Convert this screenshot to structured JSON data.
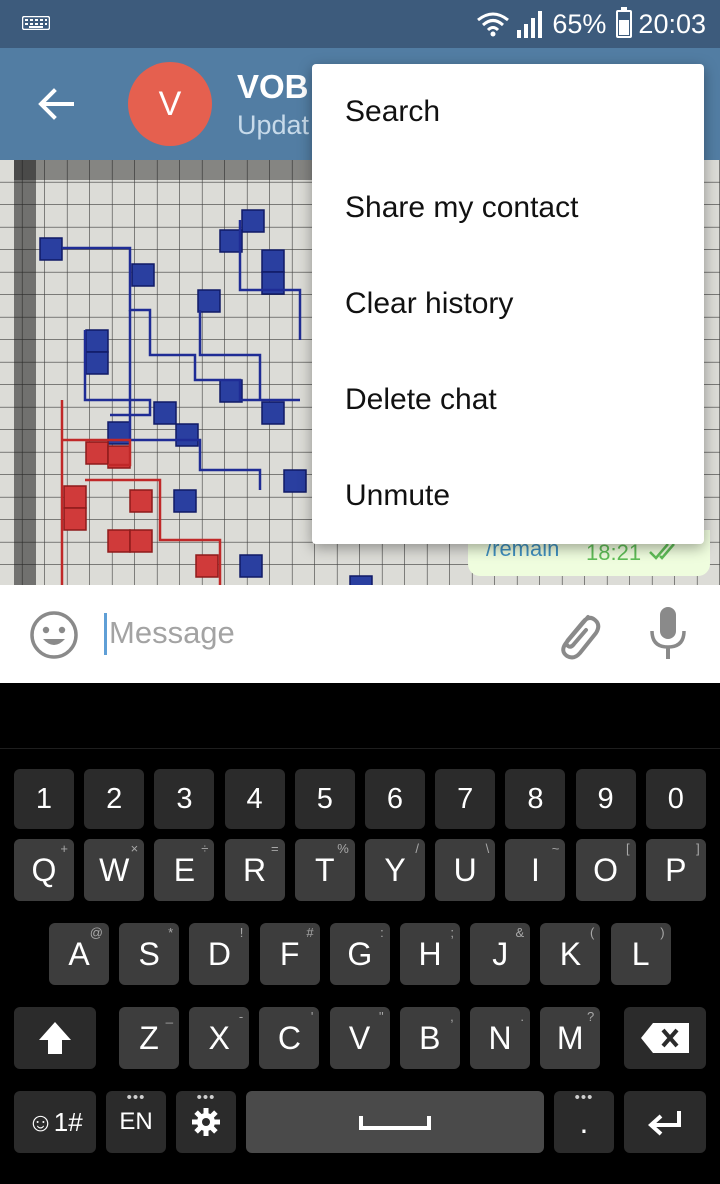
{
  "status_bar": {
    "keyboard_icon": "keyboard-icon",
    "battery_percent": "65%",
    "time": "20:03"
  },
  "header": {
    "back_icon": "arrow-left-icon",
    "avatar_letter": "V",
    "title": "VOB",
    "subtitle": "Updat"
  },
  "chat": {
    "last_message": {
      "text": "/remain",
      "time": "18:21",
      "status_icon": "double-check-icon"
    }
  },
  "menu": {
    "items": [
      {
        "label": "Search"
      },
      {
        "label": "Share my contact"
      },
      {
        "label": "Clear history"
      },
      {
        "label": "Delete chat"
      },
      {
        "label": "Unmute"
      }
    ]
  },
  "input": {
    "placeholder": "Message",
    "emoji_icon": "smile-icon",
    "attach_icon": "paperclip-icon",
    "mic_icon": "microphone-icon"
  },
  "keyboard": {
    "number_row": [
      "1",
      "2",
      "3",
      "4",
      "5",
      "6",
      "7",
      "8",
      "9",
      "0"
    ],
    "row1": [
      {
        "key": "Q",
        "hint": "+"
      },
      {
        "key": "W",
        "hint": "×"
      },
      {
        "key": "E",
        "hint": "÷"
      },
      {
        "key": "R",
        "hint": "="
      },
      {
        "key": "T",
        "hint": "%"
      },
      {
        "key": "Y",
        "hint": "/"
      },
      {
        "key": "U",
        "hint": "\\"
      },
      {
        "key": "I",
        "hint": "~"
      },
      {
        "key": "O",
        "hint": "["
      },
      {
        "key": "P",
        "hint": "]"
      }
    ],
    "row2": [
      {
        "key": "A",
        "hint": "@"
      },
      {
        "key": "S",
        "hint": "*"
      },
      {
        "key": "D",
        "hint": "!"
      },
      {
        "key": "F",
        "hint": "#"
      },
      {
        "key": "G",
        "hint": ":"
      },
      {
        "key": "H",
        "hint": ";"
      },
      {
        "key": "J",
        "hint": "&"
      },
      {
        "key": "K",
        "hint": "("
      },
      {
        "key": "L",
        "hint": ")"
      }
    ],
    "row3": [
      {
        "key": "Z",
        "hint": "_"
      },
      {
        "key": "X",
        "hint": "-"
      },
      {
        "key": "C",
        "hint": "'"
      },
      {
        "key": "V",
        "hint": "\""
      },
      {
        "key": "B",
        "hint": ","
      },
      {
        "key": "N",
        "hint": "."
      },
      {
        "key": "M",
        "hint": "?"
      }
    ],
    "symbols_label": "☺1#",
    "language_label": "EN",
    "period_label": "."
  }
}
